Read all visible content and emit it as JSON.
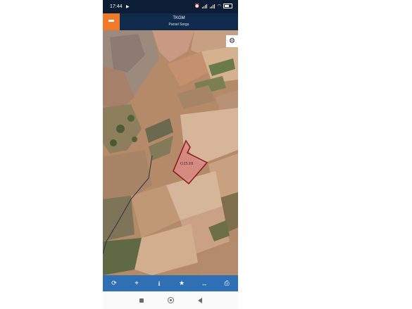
{
  "status_bar": {
    "time": "17:44",
    "icons": [
      "play-icon",
      "alarm-icon",
      "signal-icon",
      "signal-icon",
      "wifi-icon",
      "battery-icon"
    ]
  },
  "app_bar": {
    "title": "TKGM",
    "subtitle": "Parsel Sorgu",
    "menu_icon": "hamburger-menu-icon",
    "accent_color": "#ef7a2a",
    "bar_color": "#0f2a4a"
  },
  "map": {
    "parcel_label": "G15:10",
    "settings_icon": "gear-icon",
    "parcel_outline_color": "#8b1a1a"
  },
  "toolbar": {
    "color": "#2f6fb3",
    "buttons": [
      "refresh-icon",
      "locate-icon",
      "info-icon",
      "favorite-icon",
      "measure-icon",
      "print-icon"
    ]
  },
  "system_nav": {
    "buttons": [
      "recents-button",
      "home-button",
      "back-button"
    ]
  }
}
